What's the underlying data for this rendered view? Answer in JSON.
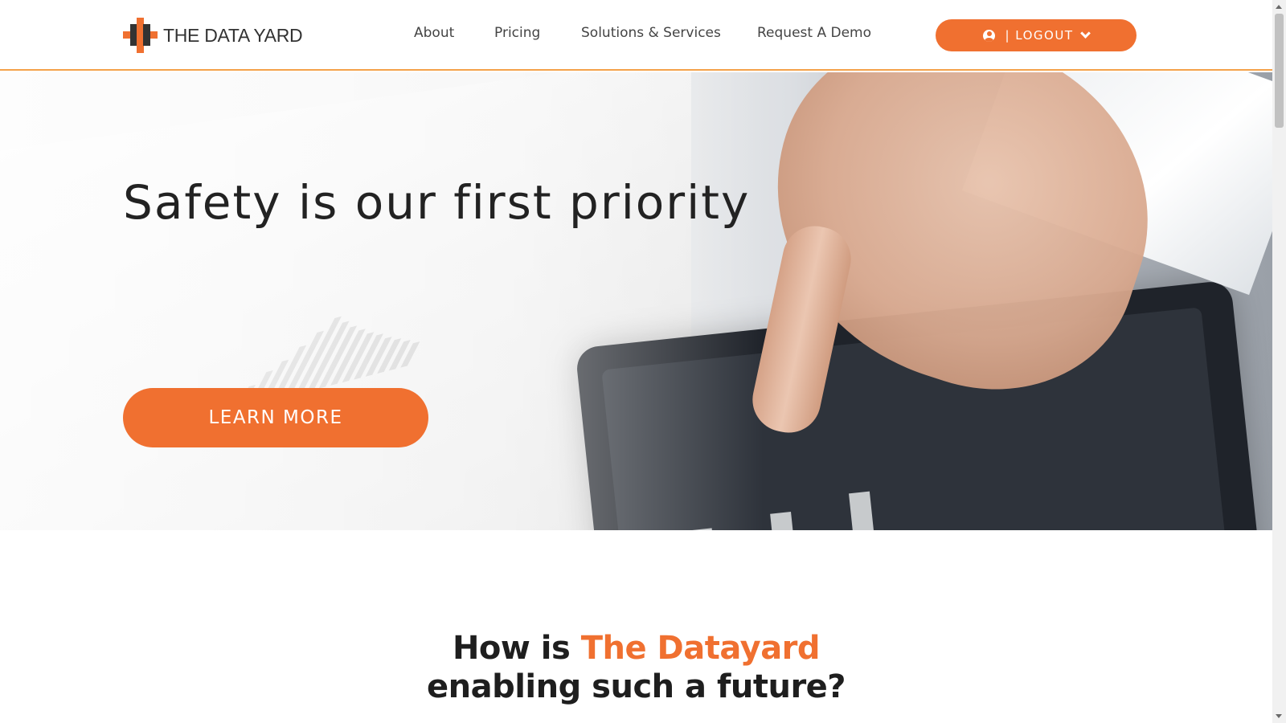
{
  "header": {
    "logo_text": "THE DATA YARD",
    "nav": [
      "About",
      "Pricing",
      "Solutions & Services",
      "Request A Demo"
    ],
    "logout_label": "| LOGOUT"
  },
  "hero": {
    "title": "Safety is our first priority",
    "button_label": "LEARN MORE"
  },
  "section": {
    "heading_part1": "How is ",
    "heading_accent": "The Datayard",
    "heading_part2": "enabling such a future?"
  },
  "colors": {
    "accent": "#f07030",
    "header_border": "#f4a24a",
    "text_dark": "#1e1e1e"
  },
  "icons": {
    "logo": "data-yard-logo-icon",
    "user": "user-circle-icon",
    "dropdown": "chevron-down-icon"
  }
}
